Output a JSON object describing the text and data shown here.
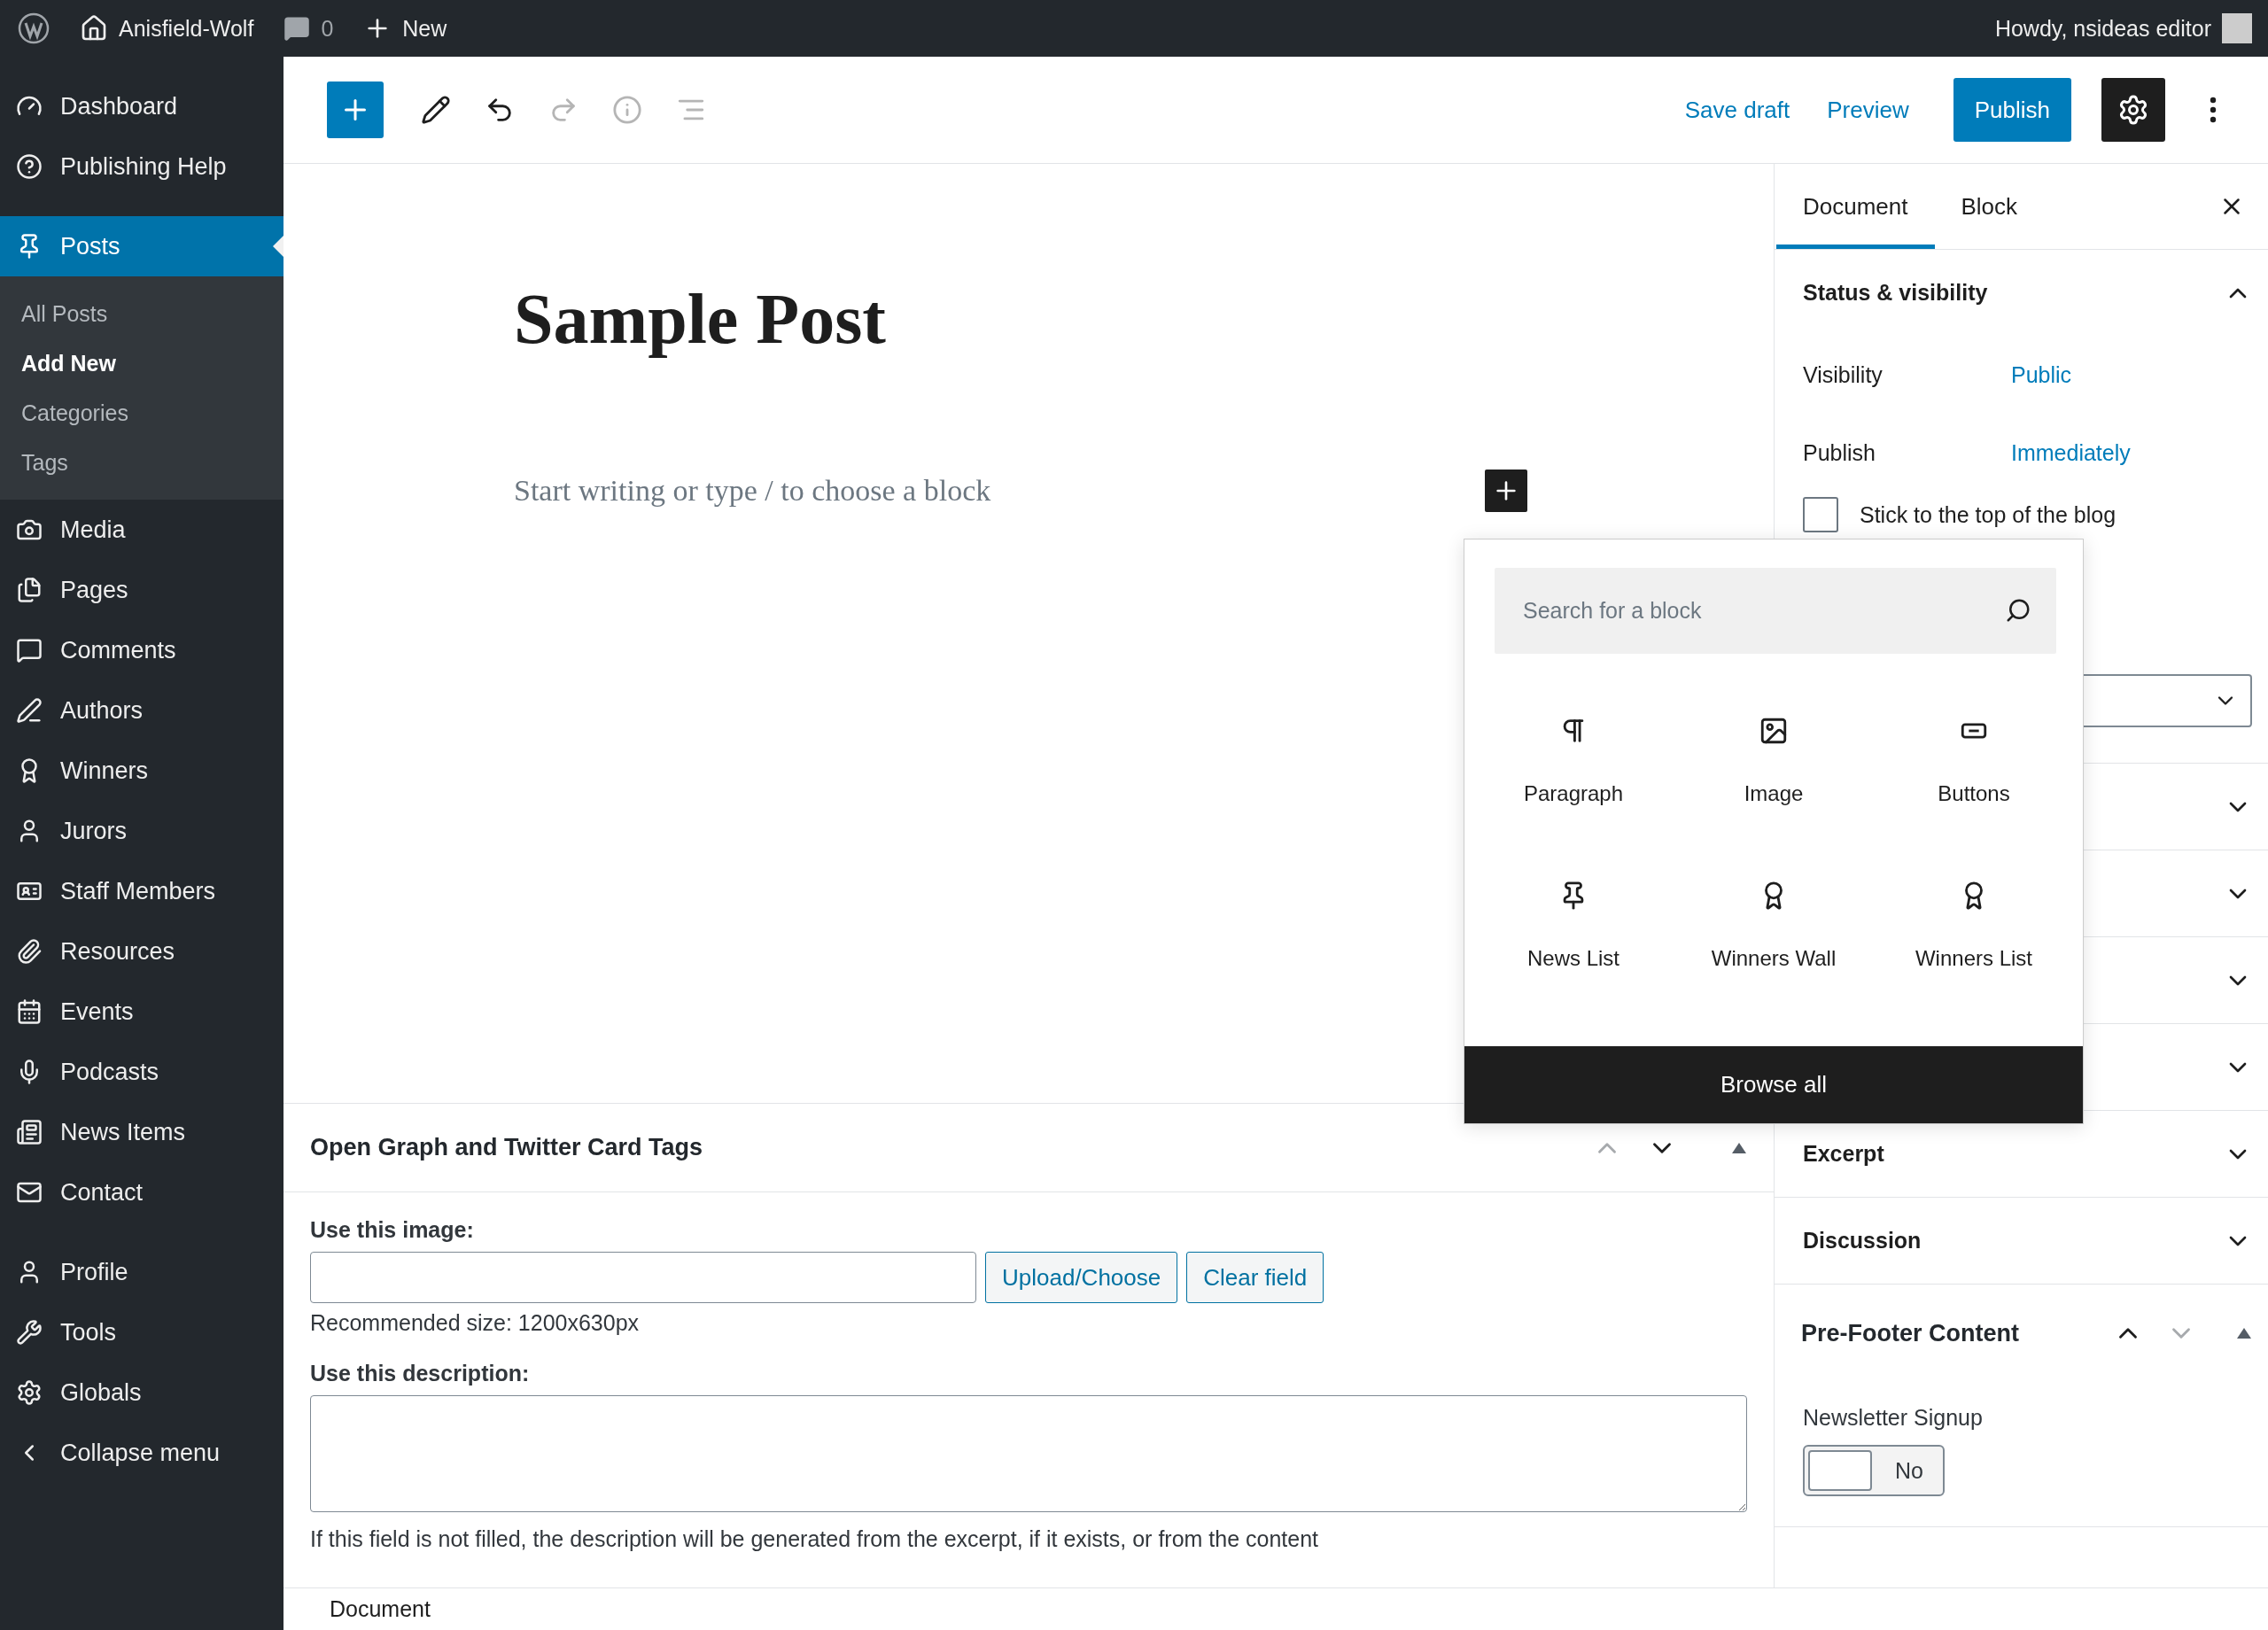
{
  "admin_bar": {
    "site_name": "Anisfield-Wolf",
    "comments_count": "0",
    "new_label": "New",
    "greeting": "Howdy, nsideas editor"
  },
  "admin_menu": {
    "groups": [
      [
        {
          "label": "Dashboard",
          "kind": "dashboard",
          "selected": false
        },
        {
          "label": "Publishing Help",
          "kind": "help",
          "selected": false
        }
      ],
      [
        {
          "label": "Posts",
          "kind": "pin",
          "selected": true,
          "children": [
            {
              "label": "All Posts",
              "selected": false
            },
            {
              "label": "Add New",
              "selected": true
            },
            {
              "label": "Categories",
              "selected": false
            },
            {
              "label": "Tags",
              "selected": false
            }
          ]
        },
        {
          "label": "Media",
          "kind": "media",
          "selected": false
        },
        {
          "label": "Pages",
          "kind": "pages",
          "selected": false
        },
        {
          "label": "Comments",
          "kind": "comment",
          "selected": false
        },
        {
          "label": "Authors",
          "kind": "pen",
          "selected": false
        },
        {
          "label": "Winners",
          "kind": "award",
          "selected": false
        },
        {
          "label": "Jurors",
          "kind": "user",
          "selected": false
        },
        {
          "label": "Staff Members",
          "kind": "card",
          "selected": false
        },
        {
          "label": "Resources",
          "kind": "link",
          "selected": false
        },
        {
          "label": "Events",
          "kind": "calendar",
          "selected": false
        },
        {
          "label": "Podcasts",
          "kind": "mic",
          "selected": false
        },
        {
          "label": "News Items",
          "kind": "news",
          "selected": false
        },
        {
          "label": "Contact",
          "kind": "mail",
          "selected": false
        }
      ],
      [
        {
          "label": "Profile",
          "kind": "user",
          "selected": false
        },
        {
          "label": "Tools",
          "kind": "wrench",
          "selected": false
        },
        {
          "label": "Globals",
          "kind": "gear",
          "selected": false
        },
        {
          "label": "Collapse menu",
          "kind": "collapse",
          "selected": false
        }
      ]
    ]
  },
  "toolbar": {
    "tools": [
      {
        "kind": "tools",
        "disabled": false
      },
      {
        "kind": "undo",
        "disabled": false
      },
      {
        "kind": "redo",
        "disabled": true
      },
      {
        "kind": "info",
        "disabled": true
      },
      {
        "kind": "outline",
        "disabled": true
      }
    ],
    "save_draft": "Save draft",
    "preview": "Preview",
    "publish": "Publish",
    "settings_active": true
  },
  "post": {
    "title": "Sample Post",
    "placeholder": "Start writing or type / to choose a block"
  },
  "inserter": {
    "search_placeholder": "Search for a block",
    "blocks": [
      {
        "label": "Paragraph",
        "kind": "paragraph"
      },
      {
        "label": "Image",
        "kind": "image"
      },
      {
        "label": "Buttons",
        "kind": "buttons"
      },
      {
        "label": "News List",
        "kind": "pin"
      },
      {
        "label": "Winners Wall",
        "kind": "award"
      },
      {
        "label": "Winners List",
        "kind": "award"
      }
    ],
    "browse_all": "Browse all"
  },
  "meta_box": {
    "title": "Open Graph and Twitter Card Tags",
    "can_move_up": false,
    "can_move_down": true,
    "image_label": "Use this image:",
    "upload_button": "Upload/Choose",
    "clear_button": "Clear field",
    "image_hint": "Recommended size: 1200x630px",
    "description_label": "Use this description:",
    "description_note": "If this field is not filled, the description will be generated from the excerpt, if it exists, or from the content"
  },
  "footer": {
    "breadcrumb": "Document"
  },
  "settings_sidebar": {
    "tabs": [
      {
        "label": "Document",
        "selected": true
      },
      {
        "label": "Block",
        "selected": false
      }
    ],
    "status": {
      "title": "Status & visibility",
      "expanded": true,
      "rows": [
        {
          "label": "Visibility",
          "value": "Public"
        },
        {
          "label": "Publish",
          "value": "Immediately"
        }
      ],
      "sticky": {
        "label": "Stick to the top of the blog",
        "checked": false
      }
    },
    "panels": [
      {
        "expanded": false
      },
      {
        "expanded": false
      },
      {
        "expanded": false
      },
      {
        "expanded": false
      },
      {
        "title": "Excerpt",
        "expanded": false
      },
      {
        "title": "Discussion",
        "expanded": false
      }
    ],
    "pre_footer": {
      "title": "Pre-Footer Content",
      "can_move_up": true,
      "can_move_down": false,
      "field_label": "Newsletter Signup",
      "toggle_text": "No",
      "on": false
    }
  }
}
